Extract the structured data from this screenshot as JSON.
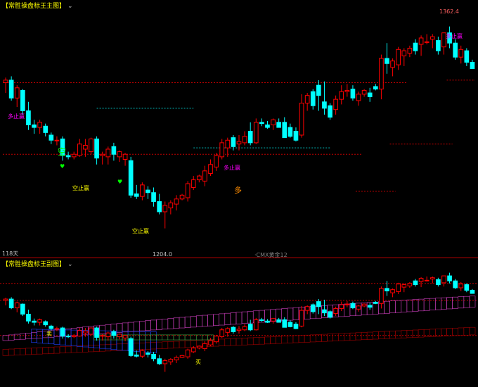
{
  "main_panel": {
    "title": "【常胜操盘标王主图】",
    "period_label": "118天",
    "max_price_label": "1362.4",
    "min_price_label": "1204.0",
    "bottom_tag": "·CMX黄金12"
  },
  "sub_panel": {
    "title": "【常胜操盘标王副图】"
  },
  "colors": {
    "up": "#ff0000",
    "down": "#00ffff",
    "dashed_red": "#c00000",
    "dashed_cyan": "#00c0c0",
    "signal_yellow": "#ffff00",
    "signal_magenta": "#ff00ff",
    "signal_green": "#00ff00",
    "signal_orange": "#ff8c00"
  },
  "signals": {
    "kong": "空",
    "duo": "多",
    "kong_zhisun": "空止赢",
    "duo_zhisun": "多止赢",
    "mai": "买",
    "mai_top": "卖",
    "heart": "♥"
  },
  "chart_data": [
    {
      "type": "candlestick",
      "title": "常胜操盘标王主图",
      "instrument": "CMX黄金12",
      "ylim": [
        1190,
        1375
      ],
      "max_label": 1362.4,
      "min_label": 1204.0,
      "candles": [
        {
          "o": 1318,
          "h": 1322,
          "l": 1310,
          "c": 1320
        },
        {
          "o": 1320,
          "h": 1323,
          "l": 1304,
          "c": 1306
        },
        {
          "o": 1306,
          "h": 1316,
          "l": 1299,
          "c": 1314
        },
        {
          "o": 1312,
          "h": 1313,
          "l": 1293,
          "c": 1296
        },
        {
          "o": 1296,
          "h": 1303,
          "l": 1281,
          "c": 1285
        },
        {
          "o": 1285,
          "h": 1289,
          "l": 1278,
          "c": 1283
        },
        {
          "o": 1283,
          "h": 1289,
          "l": 1278,
          "c": 1287
        },
        {
          "o": 1284,
          "h": 1286,
          "l": 1276,
          "c": 1279
        },
        {
          "o": 1277,
          "h": 1279,
          "l": 1270,
          "c": 1273
        },
        {
          "o": 1273,
          "h": 1276,
          "l": 1269,
          "c": 1273
        },
        {
          "o": 1274,
          "h": 1276,
          "l": 1257,
          "c": 1261
        },
        {
          "o": 1261,
          "h": 1264,
          "l": 1258,
          "c": 1260
        },
        {
          "o": 1260,
          "h": 1264,
          "l": 1258,
          "c": 1262
        },
        {
          "o": 1261,
          "h": 1274,
          "l": 1260,
          "c": 1270
        },
        {
          "o": 1266,
          "h": 1274,
          "l": 1260,
          "c": 1269
        },
        {
          "o": 1264,
          "h": 1275,
          "l": 1262,
          "c": 1274
        },
        {
          "o": 1274,
          "h": 1276,
          "l": 1254,
          "c": 1259
        },
        {
          "o": 1261,
          "h": 1264,
          "l": 1254,
          "c": 1262
        },
        {
          "o": 1260,
          "h": 1268,
          "l": 1254,
          "c": 1266
        },
        {
          "o": 1268,
          "h": 1271,
          "l": 1257,
          "c": 1262
        },
        {
          "o": 1260,
          "h": 1265,
          "l": 1256,
          "c": 1264
        },
        {
          "o": 1258,
          "h": 1263,
          "l": 1253,
          "c": 1262
        },
        {
          "o": 1257,
          "h": 1260,
          "l": 1228,
          "c": 1230
        },
        {
          "o": 1231,
          "h": 1238,
          "l": 1227,
          "c": 1229
        },
        {
          "o": 1229,
          "h": 1240,
          "l": 1226,
          "c": 1238
        },
        {
          "o": 1234,
          "h": 1237,
          "l": 1227,
          "c": 1232
        },
        {
          "o": 1232,
          "h": 1236,
          "l": 1221,
          "c": 1225
        },
        {
          "o": 1225,
          "h": 1231,
          "l": 1215,
          "c": 1217
        },
        {
          "o": 1217,
          "h": 1225,
          "l": 1204,
          "c": 1222
        },
        {
          "o": 1220,
          "h": 1226,
          "l": 1215,
          "c": 1224
        },
        {
          "o": 1223,
          "h": 1230,
          "l": 1218,
          "c": 1227
        },
        {
          "o": 1227,
          "h": 1231,
          "l": 1226,
          "c": 1230
        },
        {
          "o": 1228,
          "h": 1241,
          "l": 1225,
          "c": 1239
        },
        {
          "o": 1236,
          "h": 1245,
          "l": 1234,
          "c": 1242
        },
        {
          "o": 1242,
          "h": 1246,
          "l": 1240,
          "c": 1245
        },
        {
          "o": 1241,
          "h": 1253,
          "l": 1237,
          "c": 1249
        },
        {
          "o": 1247,
          "h": 1258,
          "l": 1245,
          "c": 1254
        },
        {
          "o": 1252,
          "h": 1263,
          "l": 1249,
          "c": 1261
        },
        {
          "o": 1260,
          "h": 1274,
          "l": 1258,
          "c": 1271
        },
        {
          "o": 1267,
          "h": 1275,
          "l": 1260,
          "c": 1273
        },
        {
          "o": 1275,
          "h": 1277,
          "l": 1265,
          "c": 1268
        },
        {
          "o": 1270,
          "h": 1277,
          "l": 1265,
          "c": 1272
        },
        {
          "o": 1271,
          "h": 1280,
          "l": 1269,
          "c": 1276
        },
        {
          "o": 1280,
          "h": 1287,
          "l": 1269,
          "c": 1271
        },
        {
          "o": 1271,
          "h": 1290,
          "l": 1270,
          "c": 1287
        },
        {
          "o": 1287,
          "h": 1290,
          "l": 1284,
          "c": 1286
        },
        {
          "o": 1285,
          "h": 1288,
          "l": 1282,
          "c": 1283
        },
        {
          "o": 1285,
          "h": 1290,
          "l": 1281,
          "c": 1289
        },
        {
          "o": 1287,
          "h": 1290,
          "l": 1283,
          "c": 1283
        },
        {
          "o": 1287,
          "h": 1291,
          "l": 1275,
          "c": 1275
        },
        {
          "o": 1283,
          "h": 1286,
          "l": 1275,
          "c": 1276
        },
        {
          "o": 1280,
          "h": 1283,
          "l": 1272,
          "c": 1273
        },
        {
          "o": 1277,
          "h": 1309,
          "l": 1275,
          "c": 1302
        },
        {
          "o": 1302,
          "h": 1310,
          "l": 1296,
          "c": 1308
        },
        {
          "o": 1311,
          "h": 1313,
          "l": 1297,
          "c": 1300
        },
        {
          "o": 1316,
          "h": 1320,
          "l": 1296,
          "c": 1308
        },
        {
          "o": 1303,
          "h": 1319,
          "l": 1293,
          "c": 1298
        },
        {
          "o": 1300,
          "h": 1302,
          "l": 1289,
          "c": 1291
        },
        {
          "o": 1297,
          "h": 1308,
          "l": 1293,
          "c": 1305
        },
        {
          "o": 1305,
          "h": 1316,
          "l": 1301,
          "c": 1311
        },
        {
          "o": 1311,
          "h": 1317,
          "l": 1307,
          "c": 1312
        },
        {
          "o": 1313,
          "h": 1316,
          "l": 1304,
          "c": 1306
        },
        {
          "o": 1304,
          "h": 1311,
          "l": 1300,
          "c": 1309
        },
        {
          "o": 1309,
          "h": 1313,
          "l": 1307,
          "c": 1312
        },
        {
          "o": 1310,
          "h": 1314,
          "l": 1303,
          "c": 1307
        },
        {
          "o": 1315,
          "h": 1317,
          "l": 1312,
          "c": 1313
        },
        {
          "o": 1313,
          "h": 1340,
          "l": 1305,
          "c": 1337
        },
        {
          "o": 1337,
          "h": 1349,
          "l": 1325,
          "c": 1333
        },
        {
          "o": 1330,
          "h": 1337,
          "l": 1323,
          "c": 1335
        },
        {
          "o": 1332,
          "h": 1346,
          "l": 1328,
          "c": 1344
        },
        {
          "o": 1339,
          "h": 1345,
          "l": 1331,
          "c": 1343
        },
        {
          "o": 1341,
          "h": 1347,
          "l": 1338,
          "c": 1345
        },
        {
          "o": 1349,
          "h": 1352,
          "l": 1340,
          "c": 1343
        },
        {
          "o": 1348,
          "h": 1355,
          "l": 1339,
          "c": 1353
        },
        {
          "o": 1350,
          "h": 1356,
          "l": 1348,
          "c": 1350
        },
        {
          "o": 1352,
          "h": 1356,
          "l": 1345,
          "c": 1354
        },
        {
          "o": 1351,
          "h": 1354,
          "l": 1340,
          "c": 1343
        },
        {
          "o": 1346,
          "h": 1357,
          "l": 1340,
          "c": 1357
        },
        {
          "o": 1357,
          "h": 1362,
          "l": 1345,
          "c": 1349
        },
        {
          "o": 1349,
          "h": 1352,
          "l": 1336,
          "c": 1338
        },
        {
          "o": 1338,
          "h": 1347,
          "l": 1333,
          "c": 1344
        },
        {
          "o": 1343,
          "h": 1345,
          "l": 1331,
          "c": 1334
        },
        {
          "o": 1334,
          "h": 1336,
          "l": 1329,
          "c": 1329
        }
      ],
      "stop_lines": {
        "cyan_resistance": [
          {
            "from": 16,
            "to": 33,
            "y": 1298
          },
          {
            "from": 33,
            "to": 57,
            "y": 1267
          }
        ],
        "red_support": [
          {
            "from": 0,
            "to": 70,
            "y": 1318
          },
          {
            "from": 0,
            "to": 62,
            "y": 1262
          },
          {
            "from": 62,
            "to": 68,
            "y": 1233
          },
          {
            "from": 68,
            "to": 78,
            "y": 1270
          },
          {
            "from": 78,
            "to": 82,
            "y": 1320
          }
        ]
      }
    },
    {
      "type": "candlestick",
      "title": "常胜操盘标王副图",
      "ylim": [
        1190,
        1375
      ],
      "bands": {
        "upper_pink": "rising channel",
        "lower_red": "rising channel",
        "blue_cloud": "resistance",
        "green_cloud": "resistance"
      }
    }
  ]
}
